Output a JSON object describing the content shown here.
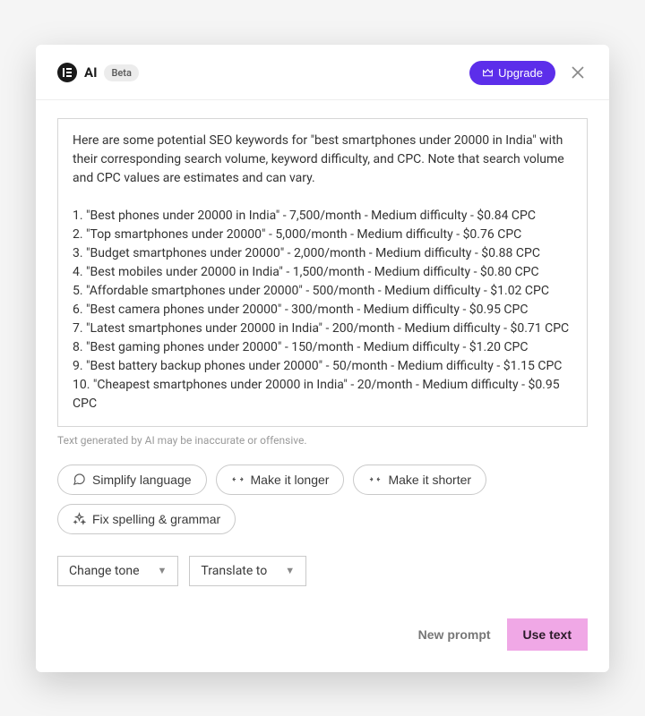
{
  "header": {
    "title": "AI",
    "beta_label": "Beta",
    "upgrade_label": "Upgrade"
  },
  "content": {
    "text": "Here are some potential SEO keywords for \"best smartphones under 20000 in India\" with their corresponding search volume, keyword difficulty, and CPC. Note that search volume and CPC values are estimates and can vary.\n\n1. \"Best phones under 20000 in India\" - 7,500/month - Medium difficulty - $0.84 CPC\n2. \"Top smartphones under 20000\" - 5,000/month - Medium difficulty - $0.76 CPC\n3. \"Budget smartphones under 20000\" - 2,000/month - Medium difficulty - $0.88 CPC\n4. \"Best mobiles under 20000 in India\" - 1,500/month - Medium difficulty - $0.80 CPC\n5. \"Affordable smartphones under 20000\" - 500/month - Medium difficulty - $1.02 CPC\n6. \"Best camera phones under 20000\" - 300/month - Medium difficulty - $0.95 CPC\n7. \"Latest smartphones under 20000 in India\" - 200/month - Medium difficulty - $0.71 CPC\n8. \"Best gaming phones under 20000\" - 150/month - Medium difficulty - $1.20 CPC\n9. \"Best battery backup phones under 20000\" - 50/month - Medium difficulty - $1.15 CPC\n10. \"Cheapest smartphones under 20000 in India\" - 20/month - Medium difficulty - $0.95 CPC"
  },
  "disclaimer": "Text generated by AI may be inaccurate or offensive.",
  "pills": {
    "simplify": "Simplify language",
    "longer": "Make it longer",
    "shorter": "Make it shorter",
    "fix": "Fix spelling & grammar"
  },
  "selects": {
    "tone": "Change tone",
    "translate": "Translate to"
  },
  "footer": {
    "new_prompt": "New prompt",
    "use_text": "Use text"
  }
}
